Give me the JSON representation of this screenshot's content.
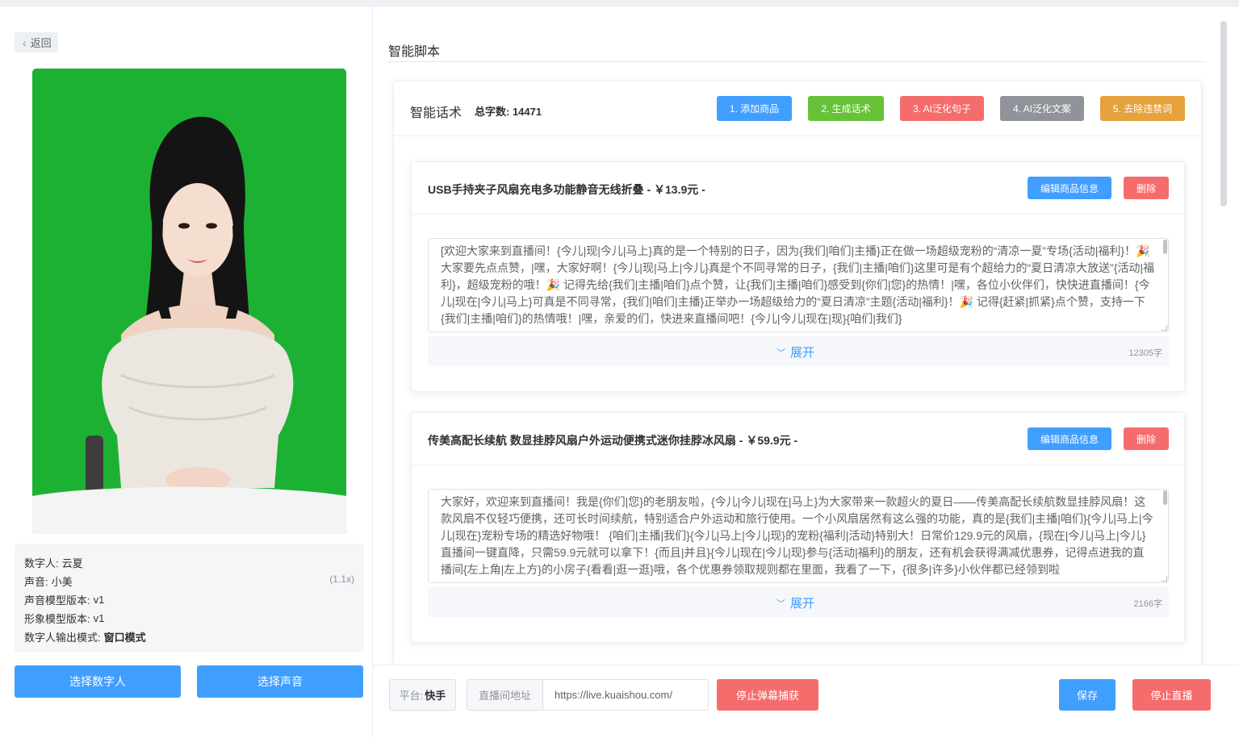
{
  "nav": {
    "back_label": "返回"
  },
  "digital_human": {
    "rows": [
      {
        "key": "数字人:",
        "value": "云夏"
      },
      {
        "key": "声音:",
        "value": "小美"
      },
      {
        "key": "声音模型版本:",
        "value": "v1"
      },
      {
        "key": "形象模型版本:",
        "value": "v1"
      },
      {
        "key": "数字人输出模式:",
        "value": "窗口模式"
      }
    ],
    "speed": "(1.1x)",
    "select_human_label": "选择数字人",
    "select_voice_label": "选择声音",
    "background_color": "#1db133"
  },
  "script": {
    "section_title": "智能脚本",
    "card_title": "智能话术",
    "total_words": "总字数: 14471",
    "steps": [
      "1. 添加商品",
      "2. 生成话术",
      "3. AI泛化句子",
      "4. AI泛化文案",
      "5. 去除违禁词"
    ],
    "products": [
      {
        "title": "USB手持夹子风扇充电多功能静音无线折叠 - ￥13.9元 -",
        "edit_label": "编辑商品信息",
        "delete_label": "删除",
        "text": "[欢迎大家来到直播间！{今儿|现|今儿|马上}真的是一个特别的日子，因为{我们|咱们|主播}正在做一场超级宠粉的“清凉一夏”专场{活动|福利}！🎉 大家要先点点赞，|嘿，大家好啊！{今儿|现|马上|今儿}真是个不同寻常的日子，{我们|主播|咱们}这里可是有个超给力的“夏日清凉大放送”{活动|福利}，超级宠粉的哦！🎉 记得先给{我们|主播|咱们}点个赞，让{我们|主播|咱们}感受到{你们|您}的热情！|嘿，各位小伙伴们，快快进直播间！{今儿|现在|今儿|马上}可真是不同寻常，{我们|咱们|主播}正举办一场超级给力的“夏日清凉”主题{活动|福利}！🎉 记得{赶紧|抓紧}点个赞，支持一下{我们|主播|咱们}的热情哦！|嘿，亲爱的们，快进来直播间吧！{今儿|今儿|现在|现}{咱们|我们}",
        "expand_label": "展开",
        "char_count": "12305字"
      },
      {
        "title": "传美高配长续航 数显挂脖风扇户外运动便携式迷你挂脖冰风扇 - ￥59.9元 -",
        "edit_label": "编辑商品信息",
        "delete_label": "删除",
        "text": "大家好，欢迎来到直播间！我是{你们|您}的老朋友啦，{今儿|今儿|现在|马上}为大家带来一款超火的夏日——传美高配长续航数显挂脖风扇！这款风扇不仅轻巧便携，还可长时间续航，特别适合户外运动和旅行使用。一个小风扇居然有这么强的功能，真的是{我们|主播|咱们}{今儿|马上|今儿|现在}宠粉专场的精选好物哦！  {咱们|主播|我们}{今儿|马上|今儿|现}的宠粉{福利|活动}特别大！日常价129.9元的风扇，{现在|今儿|马上|今儿}直播间一键直降，只需59.9元就可以拿下！{而且|并且}{今儿|现在|今儿|现}参与{活动|福利}的朋友，还有机会获得满减优惠券，记得点进我的直播间{左上角|左上方}的小房子{看看|逛一逛}哦，各个优惠券领取规则都在里面，我看了一下，{很多|许多}小伙伴都已经领到啦",
        "expand_label": "展开",
        "char_count": "2166字"
      }
    ]
  },
  "bottom_bar": {
    "platform_label": "平台:",
    "platform_value": "快手",
    "url_label": "直播间地址",
    "url_value": "https://live.kuaishou.com/",
    "stop_capture_label": "停止弹幕捕获",
    "save_label": "保存",
    "stop_live_label": "停止直播"
  }
}
